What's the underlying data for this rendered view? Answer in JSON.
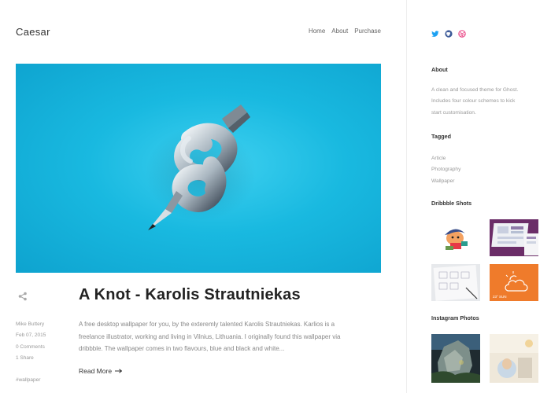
{
  "site": {
    "logo": "Caesar"
  },
  "nav": {
    "items": [
      "Home",
      "About",
      "Purchase"
    ]
  },
  "post": {
    "title": "A Knot - Karolis Strautniekas",
    "author": "Mike Buttery",
    "date": "Feb 07, 2015",
    "comments": "0 Comments",
    "shares": "1 Share",
    "tag": "#wallpaper",
    "excerpt": "A free desktop wallpaper for you, by the exteremly talented Karolis Strautniekas. Karlios is a freelance illustrator, working and living in Vilnius, Lithuania. I originally found this wallpaper via dribbble. The wallpaper comes in two flavours, blue and black and white...",
    "read_more": "Read More"
  },
  "sidebar": {
    "social_icons": [
      "twitter-icon",
      "github-icon",
      "dribbble-icon"
    ],
    "about_heading": "About",
    "about_text": "A clean and focused theme for Ghost. Includes four colour schemes to kick start customisation.",
    "tagged_heading": "Tagged",
    "tags": [
      "Article",
      "Photography",
      "Wallpaper"
    ],
    "dribbble_heading": "Dribbble Shots",
    "instagram_heading": "Instagram Photos",
    "shot_caption": "23° SUN"
  },
  "colors": {
    "hero": "#19b9e0",
    "accent_orange": "#ef7b2b",
    "twitter": "#1da1f2",
    "github": "#3b5998",
    "dribbble": "#ea4c89"
  }
}
